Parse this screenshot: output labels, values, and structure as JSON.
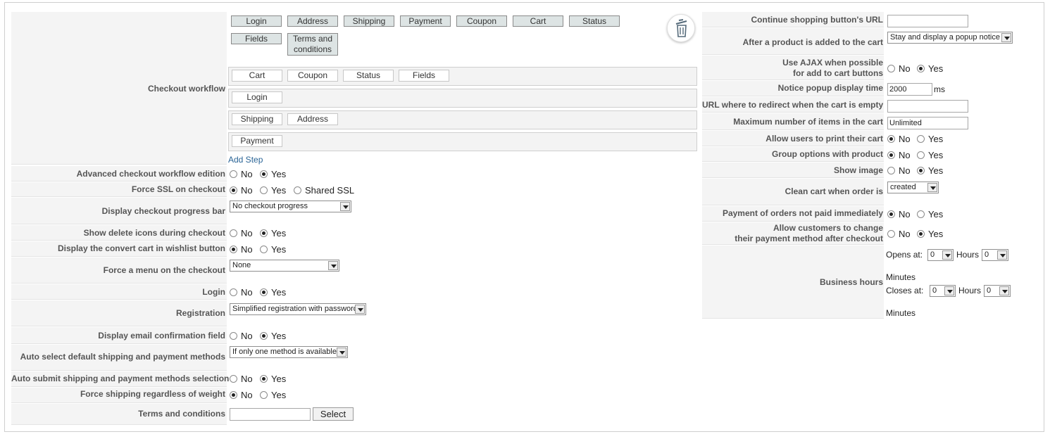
{
  "workflow": {
    "label": "Checkout workflow",
    "available_steps": [
      "Login",
      "Address",
      "Shipping",
      "Payment",
      "Coupon",
      "Cart",
      "Status",
      "Fields"
    ],
    "terms_step": [
      "Terms and",
      "conditions"
    ],
    "step1": [
      "Cart",
      "Coupon",
      "Status",
      "Fields"
    ],
    "step2": [
      "Login"
    ],
    "step3": [
      "Shipping",
      "Address"
    ],
    "step4": [
      "Payment"
    ],
    "add_step": "Add Step",
    "trash_icon": "trash-icon"
  },
  "radio_text": {
    "no": "No",
    "yes": "Yes",
    "shared_ssl": "Shared SSL"
  },
  "left": {
    "advanced": "Advanced checkout workflow edition",
    "force_ssl": "Force SSL on checkout",
    "progress_bar": "Display checkout progress bar",
    "progress_value": "No checkout progress",
    "delete_icons": "Show delete icons during checkout",
    "wishlist": "Display the convert cart in wishlist button",
    "force_menu": "Force a menu on the checkout",
    "force_menu_value": "None",
    "login": "Login",
    "registration": "Registration",
    "registration_value": "Simplified registration with password",
    "email_confirm": "Display email confirmation field",
    "auto_select": "Auto select default shipping and payment methods",
    "auto_select_value": "If only one method is available",
    "auto_submit": "Auto submit shipping and payment methods selection",
    "force_shipping": "Force shipping regardless of weight",
    "terms": "Terms and conditions",
    "select_btn": "Select"
  },
  "right": {
    "continue_url": "Continue shopping button's URL",
    "after_added": "After a product is added to the cart",
    "after_added_value": "Stay and display a popup notice",
    "ajax_1": "Use AJAX when possible",
    "ajax_2": "for add to cart buttons",
    "notice_time": "Notice popup display time",
    "notice_value": "2000",
    "notice_unit": "ms",
    "redirect_url": "URL where to redirect when the cart is empty",
    "max_items": "Maximum number of items in the cart",
    "max_items_value": "Unlimited",
    "print_cart": "Allow users to print their cart",
    "group_options": "Group options with product",
    "show_image": "Show image",
    "clean_cart": "Clean cart when order is",
    "clean_cart_value": "created",
    "payment_not_paid": "Payment of orders not paid immediately",
    "change_payment_1": "Allow customers to change",
    "change_payment_2": "their payment method after checkout",
    "business_hours": "Business hours",
    "opens_at": "Opens at:",
    "closes_at": "Closes at:",
    "hours": "Hours",
    "minutes": "Minutes",
    "zero": "0"
  }
}
